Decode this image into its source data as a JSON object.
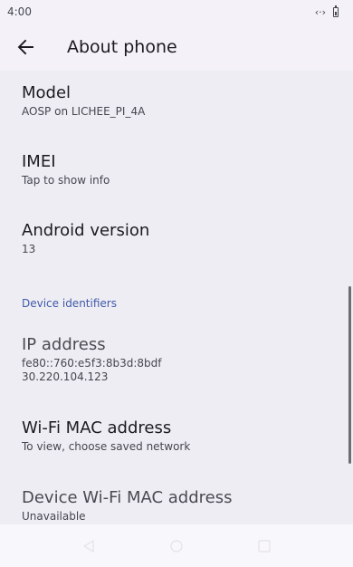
{
  "status_bar": {
    "time": "4:00",
    "icons": [
      "sync-icon",
      "battery-icon"
    ]
  },
  "app_bar": {
    "back_icon": "arrow-back-icon",
    "title": "About phone"
  },
  "items": [
    {
      "title": "Model",
      "summary": "AOSP on LICHEE_PI_4A"
    },
    {
      "title": "IMEI",
      "summary": "Tap to show info"
    },
    {
      "title": "Android version",
      "summary": "13"
    }
  ],
  "section": {
    "header": "Device identifiers",
    "items": [
      {
        "title": "IP address",
        "summary_lines": [
          "fe80::760:e5f3:8b3d:8bdf",
          "30.220.104.123"
        ]
      },
      {
        "title": "Wi-Fi MAC address",
        "summary": "To view, choose saved network"
      },
      {
        "title": "Device Wi-Fi MAC address",
        "summary": "Unavailable"
      }
    ]
  },
  "nav_bar": {
    "buttons": [
      "nav-back-icon",
      "nav-home-icon",
      "nav-recents-icon"
    ]
  },
  "colors": {
    "background": "#efedf4",
    "accent": "#3f5aa8",
    "text_primary": "#1b1b1f",
    "text_secondary": "#44464f"
  }
}
